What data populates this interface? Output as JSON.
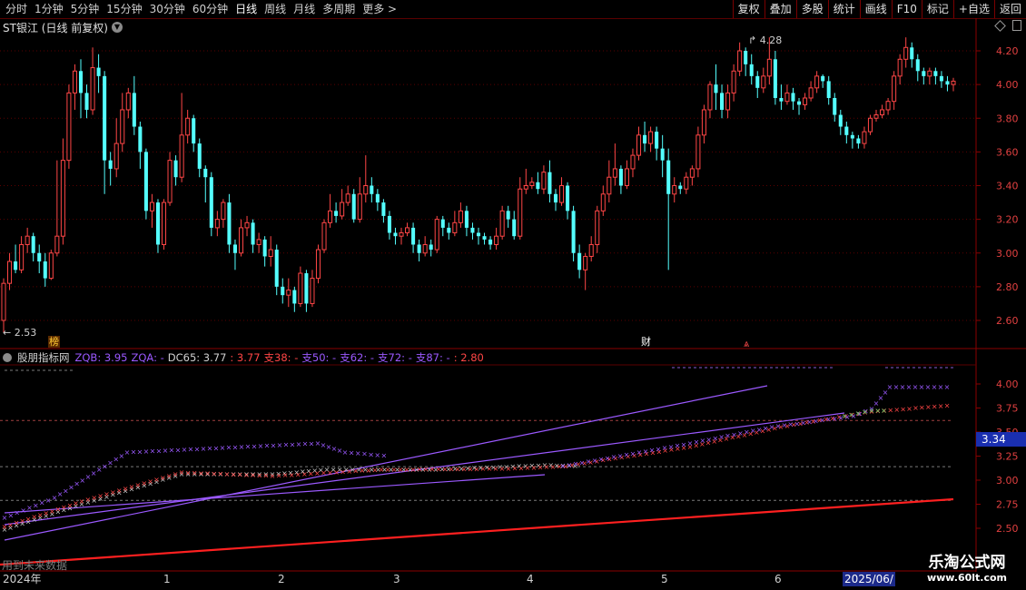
{
  "toolbar": {
    "periods": [
      "分时",
      "1分钟",
      "5分钟",
      "15分钟",
      "30分钟",
      "60分钟",
      "日线",
      "周线",
      "月线",
      "多周期",
      "更多 >"
    ],
    "buttons": [
      "复权",
      "叠加",
      "多股",
      "统计",
      "画线",
      "F10",
      "标记",
      "+自选",
      "返回"
    ]
  },
  "stock": {
    "title": "ST银江 (日线 前复权)"
  },
  "price_axis": {
    "labels": [
      "4.20",
      "4.00",
      "3.80",
      "3.60",
      "3.40",
      "3.20",
      "3.00",
      "2.80",
      "2.60"
    ]
  },
  "annotations": {
    "high": "4.28",
    "low": "2.53",
    "tag_bang": "榜",
    "tag_cai": "财",
    "tag_arrow": "⩓"
  },
  "indicator": {
    "name": "股朋指标网",
    "zqb": "ZQB: 3.95",
    "zqa": "ZQA: -",
    "dc65": "DC65: 3.77",
    "val": ": 3.77",
    "zhi38": "支38: -",
    "zhi50": "支50: -",
    "zhi62": "支62: -",
    "zhi72": "支72: -",
    "zhi87": "支87: -",
    "tail": ": 2.80",
    "axis": [
      "4.00",
      "3.75",
      "3.50",
      "3.25",
      "3.00",
      "2.75",
      "2.50"
    ],
    "current": "3.34"
  },
  "footer": {
    "note": "用到未来数据"
  },
  "xaxis": {
    "labels": [
      "2024年",
      "1",
      "2",
      "3",
      "4",
      "5",
      "6",
      "2025/06/"
    ]
  },
  "watermark": {
    "line1": "乐淘公式网",
    "line2": "www.60lt.com"
  },
  "colors": {
    "up": "#ff4646",
    "down": "#54ffff",
    "purple": "#9b59ff",
    "red_line": "#ff2020"
  },
  "chart_data": {
    "type": "candlestick",
    "y_axis": {
      "min": 2.5,
      "max": 4.3,
      "ticks": [
        2.6,
        2.8,
        3.0,
        3.2,
        3.4,
        3.6,
        3.8,
        4.0,
        4.2
      ]
    },
    "candles": [
      [
        2.6,
        2.82,
        2.53,
        2.85
      ],
      [
        2.82,
        2.95,
        2.78,
        3.0
      ],
      [
        2.95,
        2.9,
        2.88,
        3.05
      ],
      [
        2.9,
        3.05,
        2.88,
        3.1
      ],
      [
        3.05,
        3.1,
        3.0,
        3.15
      ],
      [
        3.1,
        3.0,
        2.95,
        3.12
      ],
      [
        3.0,
        2.95,
        2.88,
        3.05
      ],
      [
        2.95,
        2.85,
        2.8,
        3.0
      ],
      [
        2.85,
        3.0,
        2.84,
        3.02
      ],
      [
        3.0,
        3.1,
        2.98,
        3.55
      ],
      [
        3.1,
        3.55,
        3.05,
        3.68
      ],
      [
        3.55,
        3.95,
        3.5,
        4.0
      ],
      [
        3.95,
        4.08,
        3.85,
        4.12
      ],
      [
        4.08,
        3.95,
        3.8,
        4.15
      ],
      [
        3.95,
        3.85,
        3.8,
        4.0
      ],
      [
        3.85,
        4.1,
        3.82,
        4.22
      ],
      [
        4.1,
        4.05,
        3.95,
        4.18
      ],
      [
        4.05,
        3.55,
        3.35,
        4.08
      ],
      [
        3.55,
        3.5,
        3.4,
        3.6
      ],
      [
        3.5,
        3.65,
        3.45,
        3.8
      ],
      [
        3.65,
        3.85,
        3.6,
        3.95
      ],
      [
        3.85,
        3.95,
        3.8,
        3.98
      ],
      [
        3.95,
        3.75,
        3.7,
        4.05
      ],
      [
        3.75,
        3.6,
        3.5,
        3.78
      ],
      [
        3.6,
        3.25,
        3.2,
        3.62
      ],
      [
        3.25,
        3.3,
        3.15,
        3.35
      ],
      [
        3.3,
        3.05,
        3.0,
        3.32
      ],
      [
        3.05,
        3.3,
        3.02,
        3.32
      ],
      [
        3.3,
        3.55,
        3.28,
        3.6
      ],
      [
        3.55,
        3.45,
        3.4,
        3.58
      ],
      [
        3.45,
        3.7,
        3.42,
        3.95
      ],
      [
        3.7,
        3.8,
        3.65,
        3.85
      ],
      [
        3.8,
        3.65,
        3.6,
        3.82
      ],
      [
        3.65,
        3.5,
        3.45,
        3.68
      ],
      [
        3.5,
        3.45,
        3.3,
        3.52
      ],
      [
        3.45,
        3.15,
        3.1,
        3.48
      ],
      [
        3.15,
        3.2,
        3.1,
        3.25
      ],
      [
        3.2,
        3.3,
        3.15,
        3.32
      ],
      [
        3.3,
        3.05,
        3.0,
        3.35
      ],
      [
        3.05,
        3.0,
        2.9,
        3.08
      ],
      [
        3.0,
        3.15,
        2.98,
        3.2
      ],
      [
        3.15,
        3.18,
        3.1,
        3.22
      ],
      [
        3.18,
        3.05,
        3.0,
        3.2
      ],
      [
        3.05,
        3.08,
        3.0,
        3.12
      ],
      [
        3.08,
        2.98,
        2.92,
        3.1
      ],
      [
        2.98,
        3.02,
        2.92,
        3.1
      ],
      [
        3.02,
        2.8,
        2.75,
        3.05
      ],
      [
        2.8,
        2.75,
        2.7,
        2.85
      ],
      [
        2.75,
        2.78,
        2.68,
        2.85
      ],
      [
        2.78,
        2.7,
        2.65,
        2.8
      ],
      [
        2.7,
        2.88,
        2.68,
        2.92
      ],
      [
        2.88,
        2.7,
        2.65,
        2.9
      ],
      [
        2.7,
        2.85,
        2.68,
        2.9
      ],
      [
        2.85,
        3.02,
        2.82,
        3.05
      ],
      [
        3.02,
        3.18,
        3.0,
        3.2
      ],
      [
        3.18,
        3.25,
        3.15,
        3.35
      ],
      [
        3.25,
        3.22,
        3.18,
        3.3
      ],
      [
        3.22,
        3.3,
        3.2,
        3.38
      ],
      [
        3.3,
        3.35,
        3.28,
        3.4
      ],
      [
        3.35,
        3.2,
        3.18,
        3.38
      ],
      [
        3.2,
        3.35,
        3.18,
        3.45
      ],
      [
        3.35,
        3.4,
        3.3,
        3.58
      ],
      [
        3.4,
        3.35,
        3.3,
        3.45
      ],
      [
        3.35,
        3.3,
        3.25,
        3.38
      ],
      [
        3.3,
        3.22,
        3.18,
        3.32
      ],
      [
        3.22,
        3.12,
        3.08,
        3.25
      ],
      [
        3.12,
        3.1,
        3.05,
        3.15
      ],
      [
        3.1,
        3.12,
        3.05,
        3.15
      ],
      [
        3.12,
        3.15,
        3.1,
        3.18
      ],
      [
        3.15,
        3.05,
        3.0,
        3.18
      ],
      [
        3.05,
        3.0,
        2.95,
        3.08
      ],
      [
        3.0,
        3.05,
        2.98,
        3.1
      ],
      [
        3.05,
        3.02,
        2.98,
        3.08
      ],
      [
        3.02,
        3.2,
        3.0,
        3.22
      ],
      [
        3.2,
        3.15,
        3.1,
        3.22
      ],
      [
        3.15,
        3.12,
        3.08,
        3.18
      ],
      [
        3.12,
        3.18,
        3.1,
        3.25
      ],
      [
        3.18,
        3.25,
        3.15,
        3.3
      ],
      [
        3.25,
        3.15,
        3.1,
        3.28
      ],
      [
        3.15,
        3.12,
        3.08,
        3.18
      ],
      [
        3.12,
        3.1,
        3.05,
        3.15
      ],
      [
        3.1,
        3.08,
        3.05,
        3.12
      ],
      [
        3.08,
        3.05,
        3.02,
        3.1
      ],
      [
        3.05,
        3.1,
        3.02,
        3.15
      ],
      [
        3.1,
        3.25,
        3.08,
        3.28
      ],
      [
        3.25,
        3.2,
        3.15,
        3.28
      ],
      [
        3.2,
        3.1,
        3.08,
        3.25
      ],
      [
        3.1,
        3.38,
        3.08,
        3.45
      ],
      [
        3.38,
        3.4,
        3.35,
        3.5
      ],
      [
        3.4,
        3.42,
        3.38,
        3.45
      ],
      [
        3.42,
        3.38,
        3.35,
        3.48
      ],
      [
        3.38,
        3.48,
        3.35,
        3.52
      ],
      [
        3.48,
        3.35,
        3.3,
        3.55
      ],
      [
        3.35,
        3.3,
        3.25,
        3.38
      ],
      [
        3.3,
        3.4,
        3.28,
        3.45
      ],
      [
        3.4,
        3.25,
        3.2,
        3.42
      ],
      [
        3.25,
        3.0,
        2.95,
        3.28
      ],
      [
        3.0,
        2.9,
        2.85,
        3.05
      ],
      [
        2.9,
        2.98,
        2.78,
        3.0
      ],
      [
        2.98,
        3.05,
        2.95,
        3.1
      ],
      [
        3.05,
        3.25,
        3.0,
        3.28
      ],
      [
        3.25,
        3.35,
        3.22,
        3.4
      ],
      [
        3.35,
        3.45,
        3.3,
        3.55
      ],
      [
        3.45,
        3.5,
        3.4,
        3.65
      ],
      [
        3.5,
        3.4,
        3.35,
        3.52
      ],
      [
        3.4,
        3.5,
        3.38,
        3.55
      ],
      [
        3.5,
        3.58,
        3.45,
        3.62
      ],
      [
        3.58,
        3.7,
        3.55,
        3.75
      ],
      [
        3.7,
        3.65,
        3.6,
        3.78
      ],
      [
        3.65,
        3.72,
        3.6,
        3.75
      ],
      [
        3.72,
        3.62,
        3.55,
        3.75
      ],
      [
        3.62,
        3.55,
        3.45,
        3.7
      ],
      [
        3.55,
        3.35,
        2.9,
        3.62
      ],
      [
        3.35,
        3.4,
        3.3,
        3.45
      ],
      [
        3.4,
        3.38,
        3.35,
        3.42
      ],
      [
        3.38,
        3.45,
        3.35,
        3.48
      ],
      [
        3.45,
        3.5,
        3.4,
        3.52
      ],
      [
        3.5,
        3.7,
        3.45,
        3.75
      ],
      [
        3.7,
        3.85,
        3.65,
        3.88
      ],
      [
        3.85,
        4.0,
        3.8,
        4.02
      ],
      [
        4.0,
        3.95,
        3.85,
        4.12
      ],
      [
        3.95,
        3.85,
        3.8,
        4.0
      ],
      [
        3.85,
        3.95,
        3.8,
        4.0
      ],
      [
        3.95,
        4.08,
        3.9,
        4.12
      ],
      [
        4.08,
        4.2,
        4.05,
        4.25
      ],
      [
        4.2,
        4.12,
        4.05,
        4.22
      ],
      [
        4.12,
        4.05,
        4.0,
        4.18
      ],
      [
        4.05,
        3.98,
        3.92,
        4.08
      ],
      [
        3.98,
        4.05,
        3.95,
        4.1
      ],
      [
        4.05,
        4.15,
        4.0,
        4.28
      ],
      [
        4.15,
        3.92,
        3.88,
        4.2
      ],
      [
        3.92,
        3.9,
        3.85,
        4.0
      ],
      [
        3.9,
        3.95,
        3.88,
        4.0
      ],
      [
        3.95,
        3.9,
        3.85,
        3.98
      ],
      [
        3.9,
        3.88,
        3.82,
        3.92
      ],
      [
        3.88,
        3.92,
        3.85,
        3.95
      ],
      [
        3.92,
        3.98,
        3.9,
        4.02
      ],
      [
        3.98,
        4.05,
        3.95,
        4.08
      ],
      [
        4.05,
        4.02,
        3.98,
        4.06
      ],
      [
        4.02,
        3.92,
        3.88,
        4.05
      ],
      [
        3.92,
        3.82,
        3.78,
        3.95
      ],
      [
        3.82,
        3.75,
        3.7,
        3.85
      ],
      [
        3.75,
        3.7,
        3.65,
        3.78
      ],
      [
        3.7,
        3.68,
        3.62,
        3.72
      ],
      [
        3.68,
        3.65,
        3.62,
        3.7
      ],
      [
        3.65,
        3.72,
        3.62,
        3.75
      ],
      [
        3.72,
        3.8,
        3.7,
        3.82
      ],
      [
        3.8,
        3.82,
        3.78,
        3.85
      ],
      [
        3.82,
        3.85,
        3.8,
        3.88
      ],
      [
        3.85,
        3.9,
        3.82,
        3.92
      ],
      [
        3.9,
        4.05,
        3.85,
        4.08
      ],
      [
        4.05,
        4.15,
        4.0,
        4.18
      ],
      [
        4.15,
        4.22,
        4.1,
        4.28
      ],
      [
        4.22,
        4.15,
        4.1,
        4.25
      ],
      [
        4.15,
        4.08,
        4.02,
        4.18
      ],
      [
        4.08,
        4.05,
        4.0,
        4.1
      ],
      [
        4.05,
        4.08,
        4.0,
        4.1
      ],
      [
        4.08,
        4.05,
        4.0,
        4.1
      ],
      [
        4.05,
        4.02,
        3.98,
        4.08
      ],
      [
        4.02,
        4.0,
        3.96,
        4.05
      ],
      [
        4.0,
        4.02,
        3.96,
        4.04
      ]
    ]
  }
}
